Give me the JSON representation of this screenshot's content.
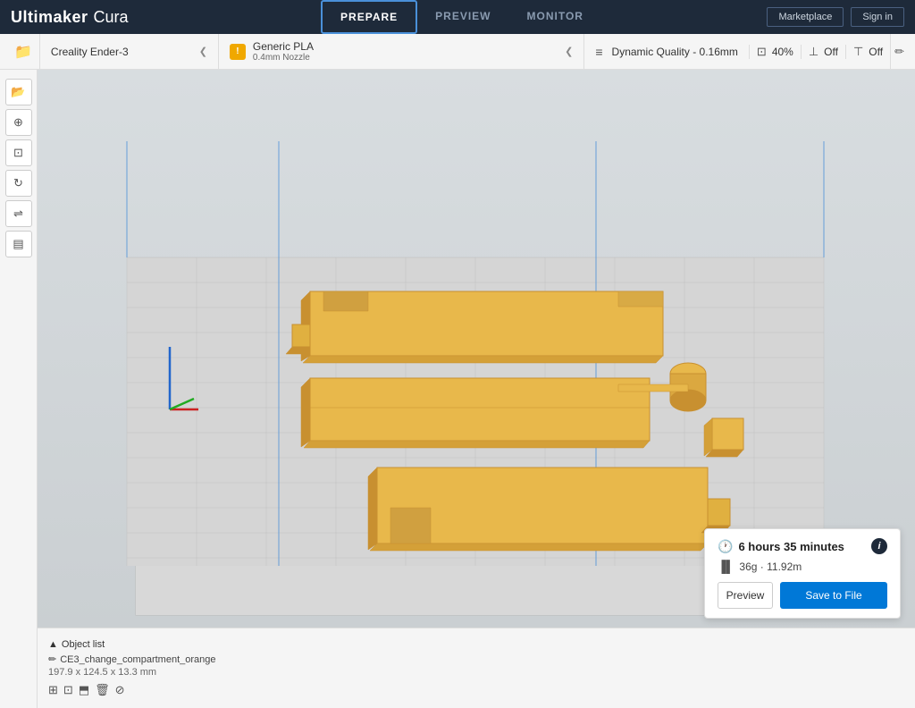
{
  "header": {
    "logo_ultimaker": "Ultimaker",
    "logo_cura": "Cura",
    "nav_tabs": [
      {
        "id": "prepare",
        "label": "PREPARE",
        "active": true
      },
      {
        "id": "preview",
        "label": "PREVIEW",
        "active": false
      },
      {
        "id": "monitor",
        "label": "MONITOR",
        "active": false
      }
    ],
    "marketplace_label": "Marketplace",
    "signin_label": "Sign in"
  },
  "toolbar": {
    "printer_name": "Creality Ender-3",
    "material_name": "Generic PLA",
    "nozzle_size": "0.4mm Nozzle",
    "quality_name": "Dynamic Quality - 0.16mm",
    "infill_value": "40%",
    "support_label": "Off",
    "adhesion_label": "Off"
  },
  "left_tools": [
    {
      "id": "open",
      "icon": "📂"
    },
    {
      "id": "move",
      "icon": "⊕"
    },
    {
      "id": "scale",
      "icon": "⊡"
    },
    {
      "id": "rotate",
      "icon": "↻"
    },
    {
      "id": "mirror",
      "icon": "⇌"
    },
    {
      "id": "arrange",
      "icon": "▤"
    }
  ],
  "bottom_panel": {
    "object_list_label": "Object list",
    "object_name": "CE3_change_compartment_orange",
    "object_dims": "197.9 x 124.5 x 13.3 mm"
  },
  "print_info": {
    "time_label": "6 hours 35 minutes",
    "filament_label": "36g · 11.92m",
    "preview_btn": "Preview",
    "save_btn": "Save to File"
  }
}
